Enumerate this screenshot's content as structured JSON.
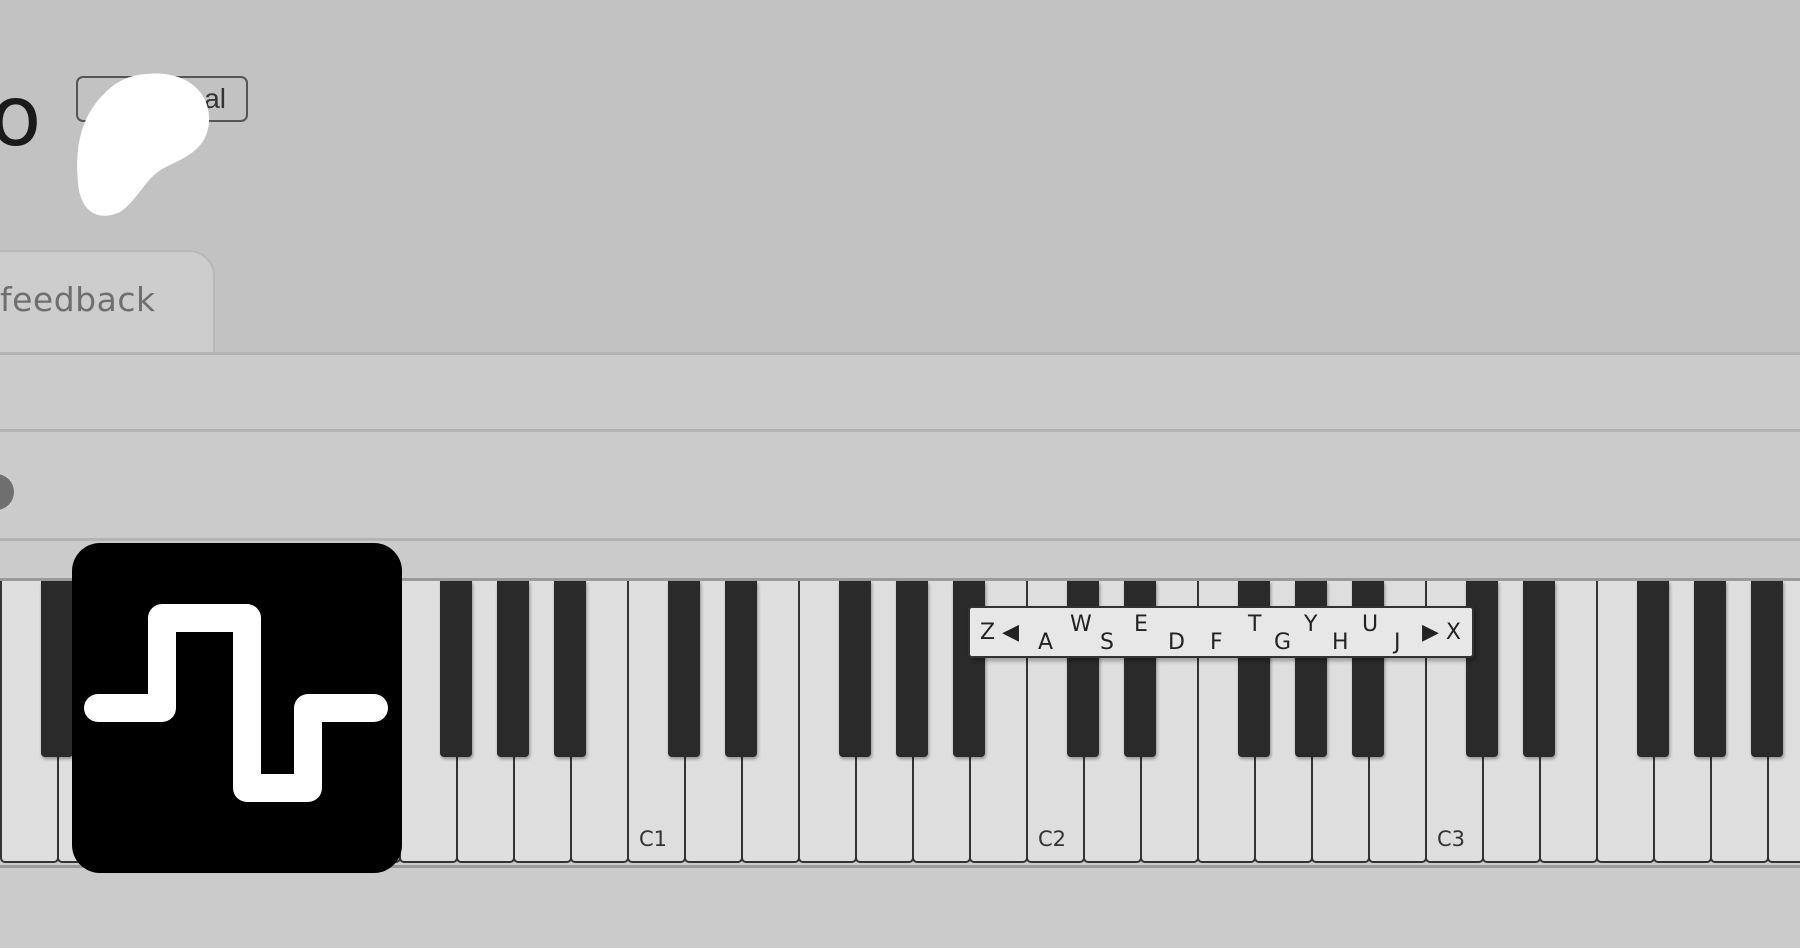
{
  "header": {
    "title_fragment": "o",
    "badge_text": "al"
  },
  "tabs": [
    {
      "label": "feedback"
    }
  ],
  "keyboard": {
    "octave_labels": [
      "C1",
      "C2",
      "C3"
    ],
    "hint": {
      "shift_down": "Z ◀",
      "shift_up": "▶ X",
      "white_keys": [
        "A",
        "S",
        "D",
        "F",
        "G",
        "H",
        "J"
      ],
      "black_keys": [
        "W",
        "E",
        "T",
        "Y",
        "U"
      ]
    }
  },
  "colors": {
    "page_bg": "#c2c2c2",
    "panel_bg": "#cbcbcb",
    "white_key": "#dedede",
    "black_key": "#2a2a2a",
    "app_icon_bg": "#000000"
  },
  "icons": {
    "app": "square-wave-icon",
    "logo": "blob-logo-icon"
  }
}
